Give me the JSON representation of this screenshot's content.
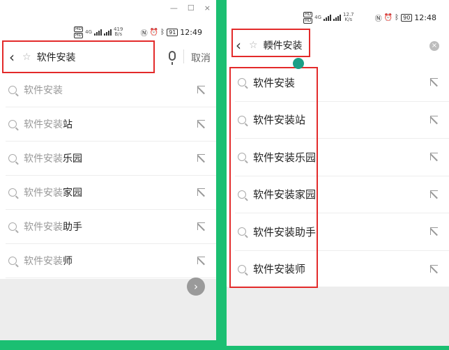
{
  "left": {
    "window_controls": [
      "—",
      "☐",
      "×"
    ],
    "status": {
      "left_badges": [
        "HD",
        "HD"
      ],
      "net_label": "4G",
      "speed_value": "419",
      "speed_unit": "B/s",
      "battery": "91",
      "time": "12:49"
    },
    "search": {
      "query": "软件安装",
      "cancel_label": "取消"
    },
    "suggestions": [
      {
        "prefix": "软件安装",
        "rest": ""
      },
      {
        "prefix": "软件安装",
        "rest": "站"
      },
      {
        "prefix": "软件安装",
        "rest": "乐园"
      },
      {
        "prefix": "软件安装",
        "rest": "家园"
      },
      {
        "prefix": "软件安装",
        "rest": "助手"
      },
      {
        "prefix": "软件安装",
        "rest": "师"
      }
    ],
    "next_button_glyph": "›"
  },
  "right": {
    "status": {
      "left_badges": [
        "HD",
        "HD"
      ],
      "net_label": "4G",
      "speed_value": "12.7",
      "speed_unit": "K/s",
      "battery": "90",
      "time": "12:48"
    },
    "search": {
      "query": "輭件安装",
      "clear_glyph": "×"
    },
    "suggestions": [
      "软件安装",
      "软件安装站",
      "软件安装乐园",
      "软件安装家园",
      "软件安装助手",
      "软件安装师"
    ]
  },
  "colors": {
    "background": "#1bbf72",
    "highlight": "#e32a2a",
    "cursor_dot": "#1b9f86"
  }
}
